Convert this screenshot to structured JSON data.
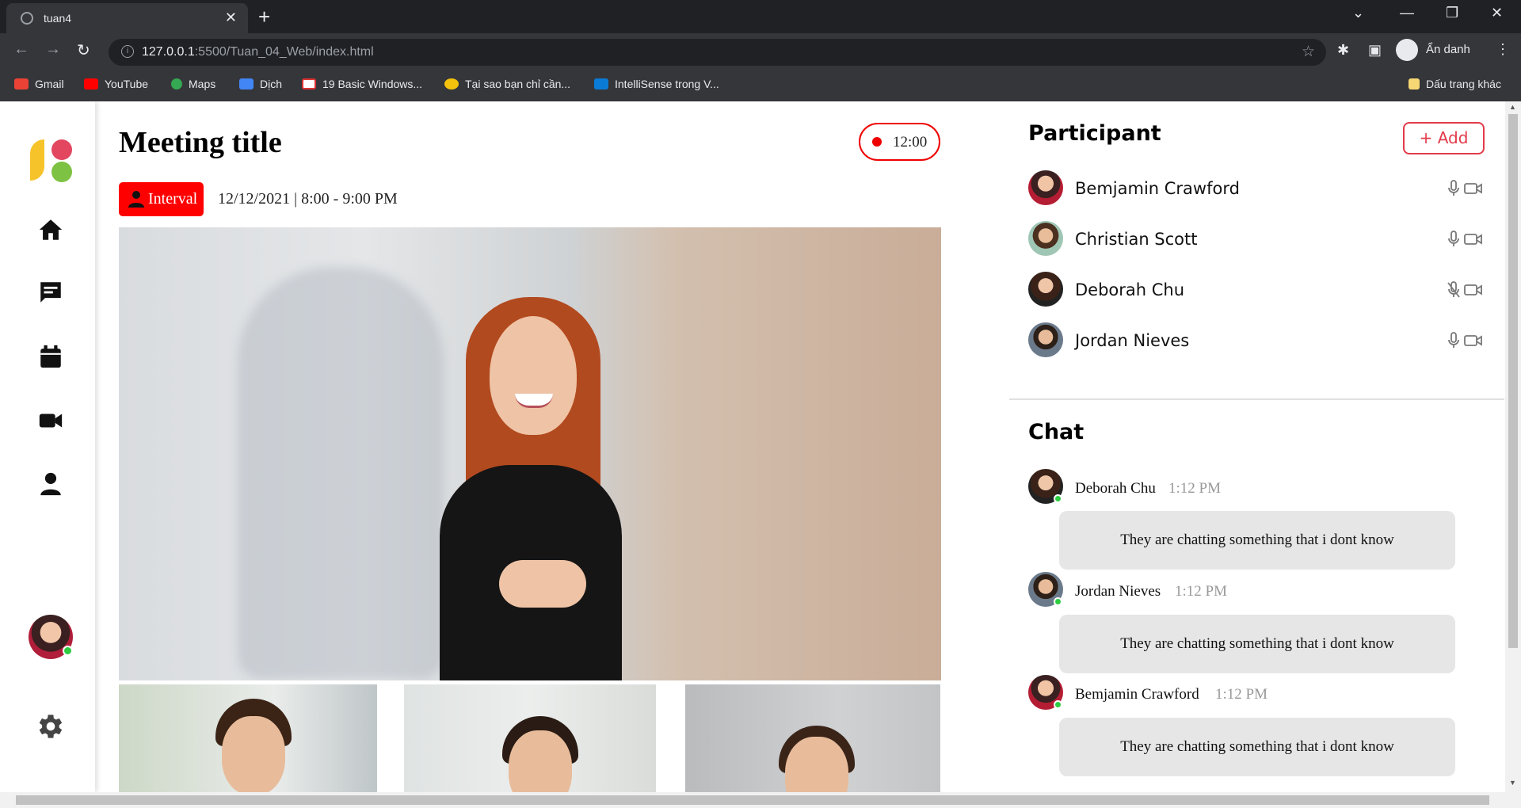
{
  "browser": {
    "tab_title": "tuan4",
    "address_host": "127.0.0.1",
    "address_path": ":5500/Tuan_04_Web/index.html",
    "profile_label": "Ẩn danh",
    "bookmarks": [
      "Gmail",
      "YouTube",
      "Maps",
      "Dịch",
      "19 Basic Windows...",
      "Tại sao bạn chỉ cần...",
      "IntelliSense trong V..."
    ],
    "other_bookmarks": "Dấu trang khác"
  },
  "meeting": {
    "title": "Meeting title",
    "timer": "12:00",
    "badge": "Interval",
    "date_time": "12/12/2021 | 8:00 - 9:00 PM"
  },
  "participants": {
    "title": "Participant",
    "add_label": "+ Add",
    "list": [
      {
        "name": "Bemjamin Crawford",
        "mic_muted": false
      },
      {
        "name": "Christian Scott",
        "mic_muted": false
      },
      {
        "name": "Deborah Chu",
        "mic_muted": true
      },
      {
        "name": "Jordan Nieves",
        "mic_muted": false
      }
    ]
  },
  "chat": {
    "title": "Chat",
    "messages": [
      {
        "sender": "Deborah Chu",
        "time": "1:12 PM",
        "text": "They are chatting something that i dont know"
      },
      {
        "sender": "Jordan Nieves",
        "time": "1:12 PM",
        "text": "They are chatting something that i dont know"
      },
      {
        "sender": "Bemjamin Crawford",
        "time": "1:12 PM",
        "text": "They are chatting something that i dont know"
      }
    ]
  },
  "icons": {
    "sidebar": [
      "home-icon",
      "chat-icon",
      "calendar-icon",
      "video-icon",
      "user-icon",
      "settings-icon"
    ]
  },
  "colors": {
    "accent": "#e23b4a",
    "record": "#ff0000",
    "online": "#2ecc40",
    "bubble": "#e6e6e6"
  }
}
